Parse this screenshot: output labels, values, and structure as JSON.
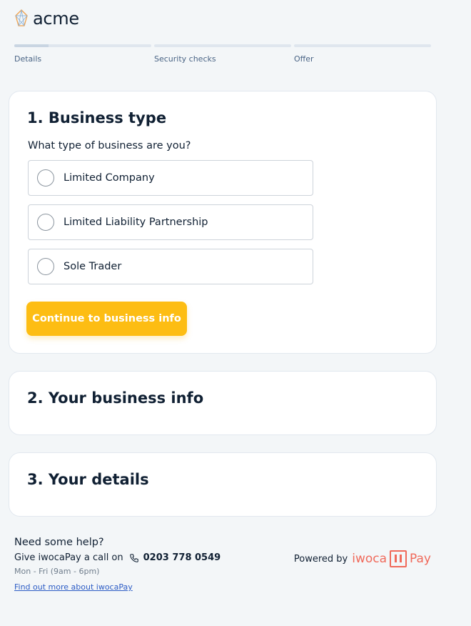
{
  "brand": {
    "name": "acme",
    "logo_icon": "geometric-diamond-icon"
  },
  "steps": [
    {
      "label": "Details",
      "progress": 0.25
    },
    {
      "label": "Security checks",
      "progress": 0
    },
    {
      "label": "Offer",
      "progress": 0
    }
  ],
  "section1": {
    "title": "1. Business type",
    "question": "What type of business are you?",
    "options": [
      {
        "label": "Limited Company",
        "selected": false
      },
      {
        "label": "Limited Liability Partnership",
        "selected": false
      },
      {
        "label": "Sole Trader",
        "selected": false
      }
    ],
    "cta": "Continue to business info"
  },
  "section2": {
    "title": "2. Your business info"
  },
  "section3": {
    "title": "3. Your details"
  },
  "help": {
    "title": "Need some help?",
    "call_text": "Give iwocaPay a call on",
    "phone": "0203 778 0549",
    "hours": "Mon - Fri (9am - 6pm)",
    "link": "Find out more about iwocaPay"
  },
  "powered": {
    "prefix": "Powered by",
    "brand_word": "iwoca",
    "brand_suffix": "Pay"
  },
  "colors": {
    "accent": "#fdbd13",
    "brand_red": "#f0695a",
    "text": "#102033"
  }
}
